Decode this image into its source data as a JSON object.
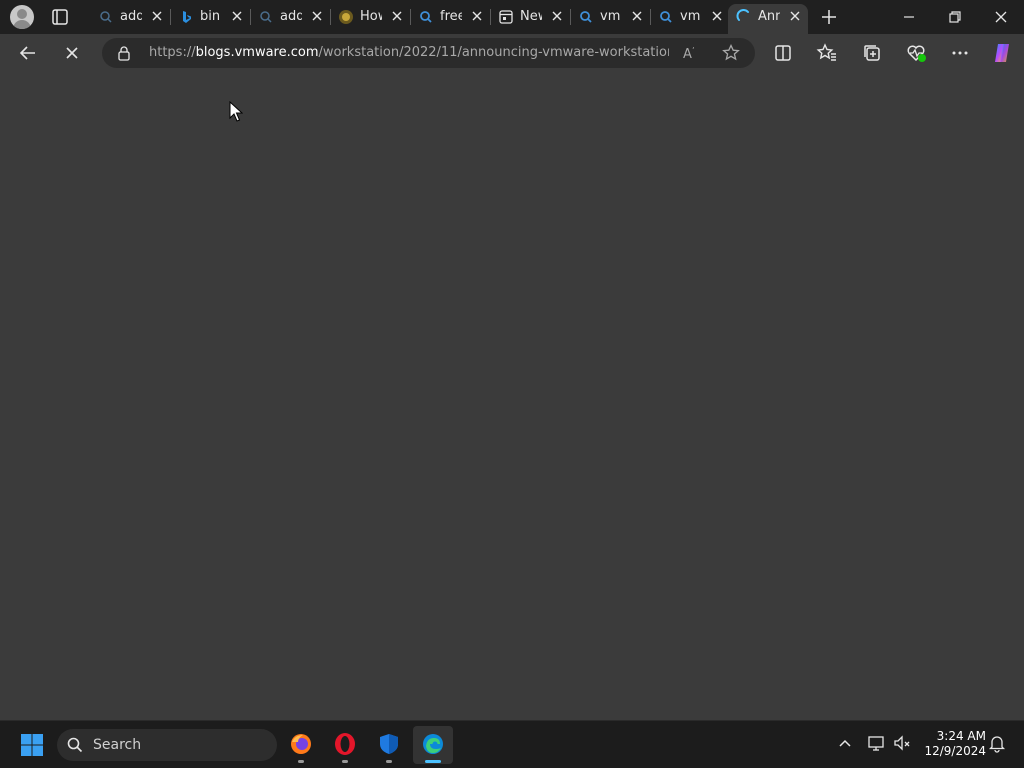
{
  "browser": {
    "tabs": [
      {
        "label": "add",
        "icon": "search-icon"
      },
      {
        "label": "bin",
        "icon": "bing-icon"
      },
      {
        "label": "add",
        "icon": "search-icon"
      },
      {
        "label": "How",
        "icon": "site-favicon"
      },
      {
        "label": "free",
        "icon": "search-icon"
      },
      {
        "label": "New",
        "icon": "newtab-icon"
      },
      {
        "label": "vm",
        "icon": "search-icon"
      },
      {
        "label": "vm",
        "icon": "search-icon"
      },
      {
        "label": "Ann",
        "icon": "loading-spinner-icon",
        "active": true
      }
    ],
    "address": {
      "scheme": "https://",
      "host": "blogs.vmware.com",
      "path": "/workstation/2022/11/announcing-vmware-workstation..."
    }
  },
  "taskbar": {
    "search_label": "Search",
    "apps": [
      "firefox-icon",
      "opera-icon",
      "defender-icon",
      "edge-icon"
    ],
    "time": "3:24 AM",
    "date": "12/9/2024"
  },
  "colors": {
    "page_bg": "#3b3b3b",
    "tabstrip_bg": "#202020",
    "taskbar_bg": "#1c1c1c",
    "accent": "#4cc2ff"
  }
}
